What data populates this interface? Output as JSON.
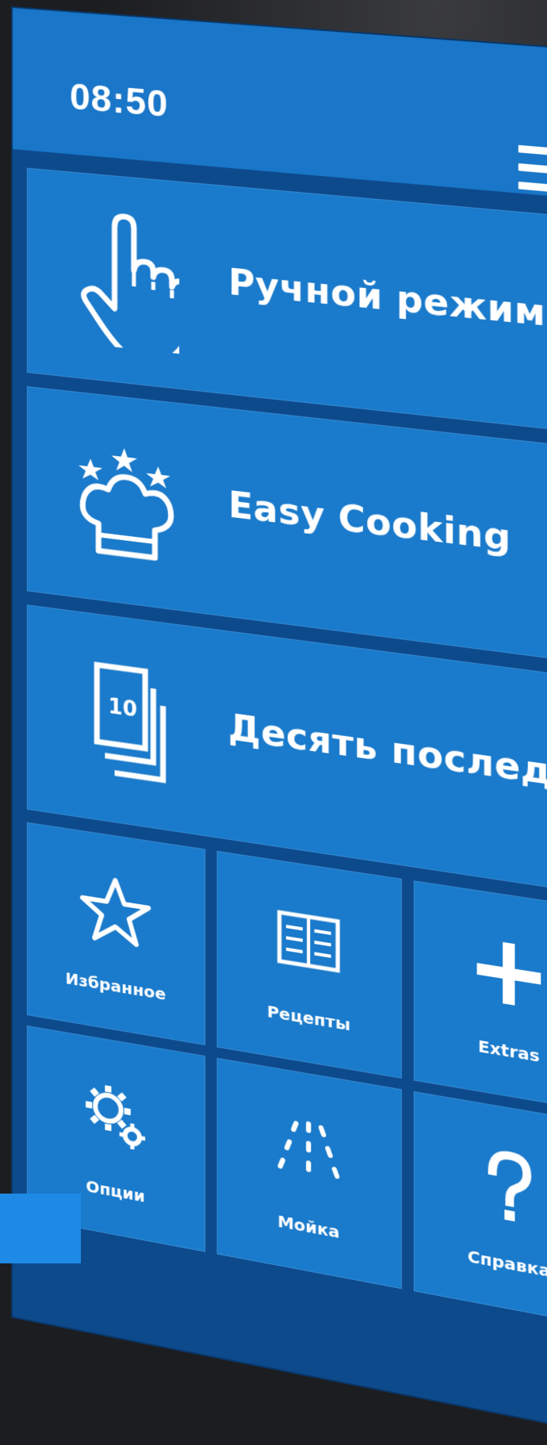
{
  "status_bar": {
    "time": "08:50"
  },
  "menu_icon": "hamburger-icon",
  "main_tiles": [
    {
      "label": "Ручной режим",
      "icon": "hand-pointer-icon"
    },
    {
      "label": "Easy Cooking",
      "icon": "chef-hat-stars-icon"
    },
    {
      "label": "Десять последних",
      "icon": "last-ten-stack-icon",
      "badge": "10"
    }
  ],
  "grid_tiles": [
    {
      "label": "Избранное",
      "icon": "star-icon"
    },
    {
      "label": "Рецепты",
      "icon": "recipe-book-icon"
    },
    {
      "label": "Extras",
      "icon": "plus-icon"
    },
    {
      "label": "Опции",
      "icon": "gears-icon"
    },
    {
      "label": "Мойка",
      "icon": "water-spray-icon"
    },
    {
      "label": "Справка",
      "icon": "question-icon"
    }
  ],
  "colors": {
    "tile": "#1a7acb",
    "background": "#0d4a8c",
    "text": "#ffffff"
  }
}
